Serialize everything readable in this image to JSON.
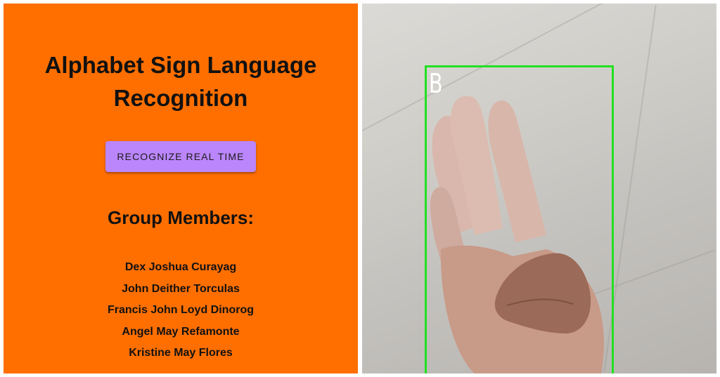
{
  "app": {
    "title_lines": [
      "Alphabet Sign Language",
      "Recognition"
    ]
  },
  "actions": {
    "recognize_label": "RECOGNIZE REAL TIME"
  },
  "group": {
    "heading": "Group Members:",
    "members": [
      "Dex Joshua Curayag",
      "John Deither Torculas",
      "Francis John Loyd Dinorog",
      "Angel May Refamonte",
      "Kristine May Flores"
    ]
  },
  "camera": {
    "detected_letter": "B",
    "box_color": "#22e022"
  },
  "colors": {
    "panel_background": "#ff6f00",
    "button_background": "#bb86fc"
  }
}
